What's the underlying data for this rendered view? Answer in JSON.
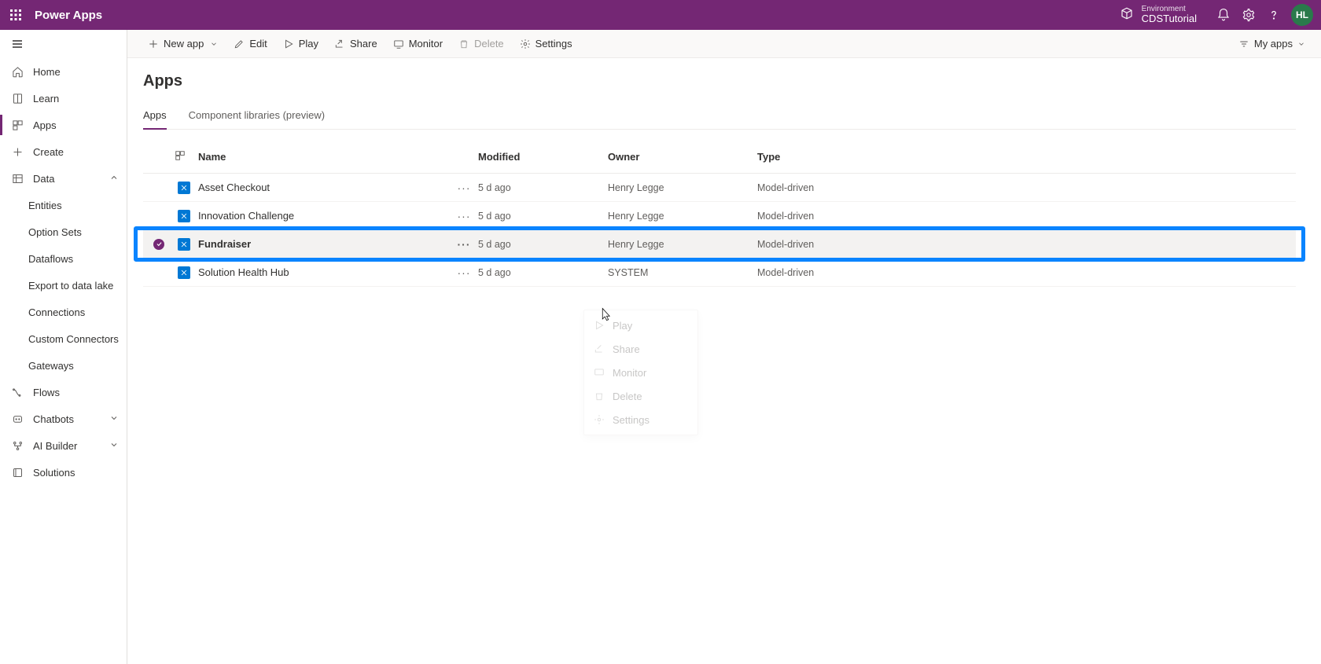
{
  "header": {
    "brand": "Power Apps",
    "env_label": "Environment",
    "env_name": "CDSTutorial",
    "avatar": "HL"
  },
  "sidebar": {
    "items": [
      {
        "label": "Home",
        "icon": "home"
      },
      {
        "label": "Learn",
        "icon": "book"
      },
      {
        "label": "Apps",
        "icon": "apps",
        "active": true
      },
      {
        "label": "Create",
        "icon": "plus"
      },
      {
        "label": "Data",
        "icon": "grid",
        "expanded": true,
        "children": [
          {
            "label": "Entities"
          },
          {
            "label": "Option Sets"
          },
          {
            "label": "Dataflows"
          },
          {
            "label": "Export to data lake"
          },
          {
            "label": "Connections"
          },
          {
            "label": "Custom Connectors"
          },
          {
            "label": "Gateways"
          }
        ]
      },
      {
        "label": "Flows",
        "icon": "flow"
      },
      {
        "label": "Chatbots",
        "icon": "bot",
        "chevron": "down"
      },
      {
        "label": "AI Builder",
        "icon": "ai",
        "chevron": "down"
      },
      {
        "label": "Solutions",
        "icon": "solution"
      }
    ]
  },
  "cmdbar": {
    "newapp": "New app",
    "edit": "Edit",
    "play": "Play",
    "share": "Share",
    "monitor": "Monitor",
    "delete": "Delete",
    "settings": "Settings",
    "myapps": "My apps"
  },
  "page": {
    "title": "Apps",
    "tabs": [
      {
        "label": "Apps",
        "active": true
      },
      {
        "label": "Component libraries (preview)"
      }
    ]
  },
  "grid": {
    "columns": {
      "name": "Name",
      "modified": "Modified",
      "owner": "Owner",
      "type": "Type"
    },
    "rows": [
      {
        "name": "Asset Checkout",
        "modified": "5 d ago",
        "owner": "Henry Legge",
        "type": "Model-driven"
      },
      {
        "name": "Innovation Challenge",
        "modified": "5 d ago",
        "owner": "Henry Legge",
        "type": "Model-driven"
      },
      {
        "name": "Fundraiser",
        "modified": "5 d ago",
        "owner": "Henry Legge",
        "type": "Model-driven",
        "selected": true
      },
      {
        "name": "Solution Health Hub",
        "modified": "5 d ago",
        "owner": "SYSTEM",
        "type": "Model-driven"
      }
    ]
  },
  "context_menu": {
    "items": [
      {
        "label": "Play",
        "icon": "play"
      },
      {
        "label": "Share",
        "icon": "share"
      },
      {
        "label": "Monitor",
        "icon": "monitor"
      },
      {
        "label": "Delete",
        "icon": "delete"
      },
      {
        "label": "Settings",
        "icon": "settings"
      }
    ]
  }
}
